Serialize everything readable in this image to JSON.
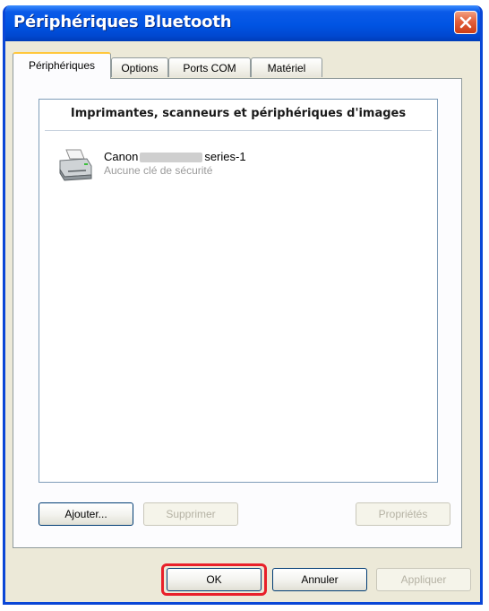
{
  "window": {
    "title": "Périphériques Bluetooth"
  },
  "tabs": [
    {
      "label": "Périphériques",
      "active": true
    },
    {
      "label": "Options",
      "active": false
    },
    {
      "label": "Ports COM",
      "active": false
    },
    {
      "label": "Matériel",
      "active": false
    }
  ],
  "device_list": {
    "group_header": "Imprimantes, scanneurs et périphériques d'images",
    "items": [
      {
        "name_prefix": "Canon",
        "name_suffix": "series-1",
        "status": "Aucune clé de sécurité",
        "icon": "printer-icon"
      }
    ]
  },
  "panel_buttons": {
    "add": "Ajouter...",
    "remove": "Supprimer",
    "properties": "Propriétés"
  },
  "dialog_buttons": {
    "ok": "OK",
    "cancel": "Annuler",
    "apply": "Appliquer"
  },
  "colors": {
    "titlebar": "#0054e3",
    "highlight": "#e8202a"
  }
}
